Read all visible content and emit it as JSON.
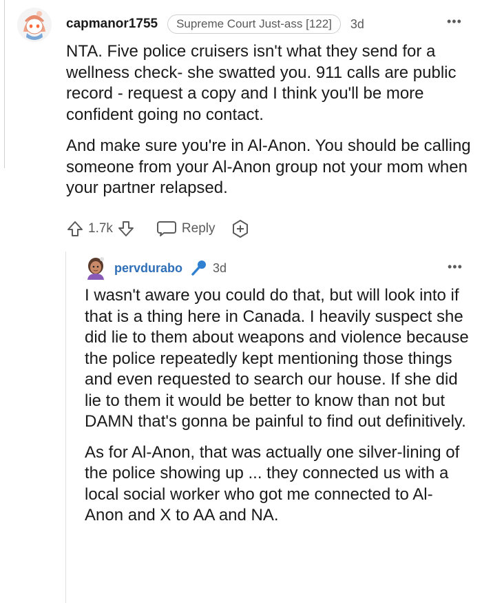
{
  "comment": {
    "username": "capmanor1755",
    "flair": "Supreme Court Just-ass [122]",
    "age": "3d",
    "more": "•••",
    "paragraphs": [
      "NTA. Five police cruisers isn't what they send for a wellness check- she swatted you. 911 calls are public record - request a copy and I think you'll be more confident going no contact.",
      "And make sure you're in Al-Anon. You should be calling someone from your Al-Anon group not your mom when your partner relapsed."
    ],
    "actions": {
      "votes": "1.7k",
      "reply_label": "Reply"
    }
  },
  "reply": {
    "username": "pervdurabo",
    "age": "3d",
    "more": "•••",
    "paragraphs": [
      "I wasn't aware you could do that, but will look into if that is a thing here in Canada. I heavily suspect she did lie to them about weapons and violence because the police repeatedly kept mentioning those things and even requested to search our house. If she did lie to them it would be better to know than not but DAMN that's gonna be painful to find out definitively.",
      "As for Al-Anon, that was actually one silver-lining of the police showing up ... they connected us with a local social worker who got me connected to Al-Anon and X to AA and NA."
    ]
  },
  "colors": {
    "reply_username": "#2f6fb8",
    "mic_icon": "#2f80d0",
    "meta_gray": "#5a5a5a"
  }
}
